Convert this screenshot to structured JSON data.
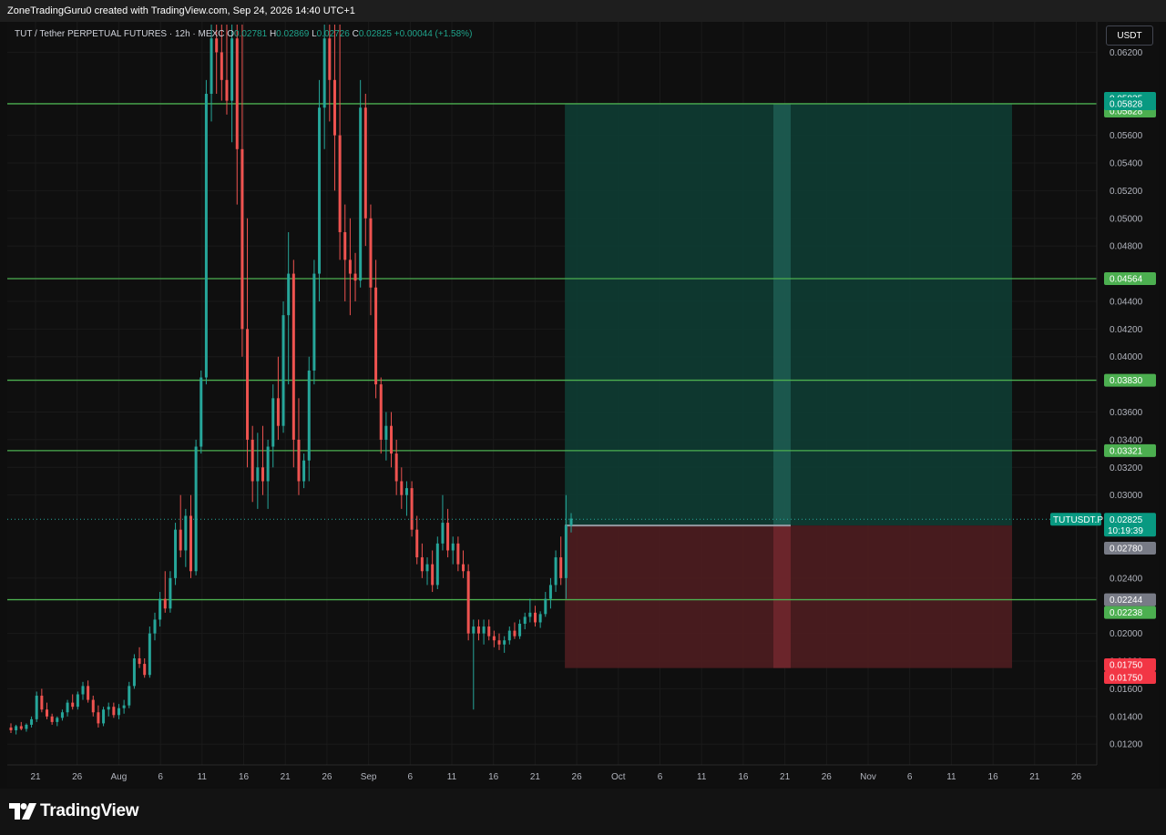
{
  "header": {
    "attribution": "ZoneTradingGuru0 created with TradingView.com, Sep 24, 2026 14:40 UTC+1"
  },
  "legend": {
    "symbol": "TUT / Tether PERPETUAL FUTURES · 12h · MEXC",
    "open_label": "O",
    "open": "0.02781",
    "high_label": "H",
    "high": "0.02869",
    "low_label": "L",
    "low": "0.02726",
    "close_label": "C",
    "close": "0.02825",
    "change": "+0.00044 (+1.58%)"
  },
  "currency_button": "USDT",
  "branding": {
    "logo_text": "TradingView"
  },
  "colors": {
    "up": "#26a69a",
    "down": "#ef5350",
    "level_line": "#4caf50",
    "target_zone": "#0f3a32",
    "stop_zone": "#4b1c20"
  },
  "chart_data": {
    "type": "candlestick",
    "symbol": "TUTUSDT.P",
    "timeframe": "12h",
    "y_axis": {
      "ticks": [
        "0.06200",
        "0.05600",
        "0.05400",
        "0.05200",
        "0.05000",
        "0.04800",
        "0.04400",
        "0.04200",
        "0.04000",
        "0.03600",
        "0.03400",
        "0.03200",
        "0.03000",
        "0.02400",
        "0.02000",
        "0.01800",
        "0.01600",
        "0.01400",
        "0.01200"
      ],
      "ylim": [
        0.0105,
        0.0642
      ]
    },
    "x_axis": {
      "ticks": [
        "21",
        "26",
        "Aug",
        "6",
        "11",
        "16",
        "21",
        "26",
        "Sep",
        "6",
        "11",
        "16",
        "21",
        "26",
        "Oct",
        "6",
        "11",
        "16",
        "21",
        "26",
        "Nov",
        "6",
        "11",
        "16",
        "21",
        "26"
      ]
    },
    "levels": [
      {
        "price": 0.05828,
        "label": "0.05828"
      },
      {
        "price": 0.04564,
        "label": "0.04564"
      },
      {
        "price": 0.0383,
        "label": "0.03830"
      },
      {
        "price": 0.03321,
        "label": "0.03321"
      },
      {
        "price": 0.02244,
        "label": "0.02244"
      }
    ],
    "position": {
      "type": "long",
      "entry": 0.0278,
      "target": 0.05828,
      "stop": 0.0175,
      "start_tick": "26",
      "end_after_tick": "16"
    },
    "price_labels": [
      {
        "text": "0.05835",
        "price": 0.05835,
        "kind": "up"
      },
      {
        "text": "0.05828",
        "price": 0.05828,
        "kind": "level"
      },
      {
        "text": "0.05828",
        "price": 0.05828,
        "kind": "up"
      },
      {
        "text": "0.04564",
        "price": 0.04564,
        "kind": "level"
      },
      {
        "text": "0.03830",
        "price": 0.0383,
        "kind": "level"
      },
      {
        "text": "0.03321",
        "price": 0.03321,
        "kind": "level"
      },
      {
        "text": "0.02780",
        "price": 0.0278,
        "kind": "gray"
      },
      {
        "text": "0.02244",
        "price": 0.02244,
        "kind": "gray"
      },
      {
        "text": "0.02238",
        "price": 0.02238,
        "kind": "level"
      },
      {
        "text": "0.01750",
        "price": 0.0175,
        "kind": "down"
      },
      {
        "text": "0.01750",
        "price": 0.0175,
        "kind": "down"
      }
    ],
    "last_price": {
      "symbol": "TUTUSDT.P",
      "value": "0.02825",
      "countdown": "10:19:39",
      "price": 0.02825
    },
    "ohlc": [
      [
        0.0132,
        0.0135,
        0.0128,
        0.013
      ],
      [
        0.013,
        0.0134,
        0.0127,
        0.0133
      ],
      [
        0.0133,
        0.0136,
        0.013,
        0.0131
      ],
      [
        0.0131,
        0.0135,
        0.0129,
        0.0134
      ],
      [
        0.0134,
        0.014,
        0.0132,
        0.0138
      ],
      [
        0.0138,
        0.0158,
        0.0136,
        0.0155
      ],
      [
        0.0155,
        0.016,
        0.0143,
        0.0145
      ],
      [
        0.0145,
        0.015,
        0.0138,
        0.014
      ],
      [
        0.014,
        0.0142,
        0.0134,
        0.0136
      ],
      [
        0.0136,
        0.014,
        0.0133,
        0.0139
      ],
      [
        0.0139,
        0.0145,
        0.0137,
        0.0143
      ],
      [
        0.0143,
        0.0152,
        0.014,
        0.015
      ],
      [
        0.015,
        0.0156,
        0.0145,
        0.0147
      ],
      [
        0.0147,
        0.0158,
        0.0145,
        0.0156
      ],
      [
        0.0156,
        0.0165,
        0.0152,
        0.0162
      ],
      [
        0.0162,
        0.0166,
        0.015,
        0.0152
      ],
      [
        0.0152,
        0.0155,
        0.014,
        0.0143
      ],
      [
        0.0143,
        0.0148,
        0.0132,
        0.0135
      ],
      [
        0.0135,
        0.0147,
        0.0133,
        0.0145
      ],
      [
        0.0145,
        0.015,
        0.014,
        0.0147
      ],
      [
        0.0147,
        0.015,
        0.0139,
        0.0141
      ],
      [
        0.0141,
        0.0149,
        0.0138,
        0.0146
      ],
      [
        0.0146,
        0.0152,
        0.0142,
        0.0148
      ],
      [
        0.0148,
        0.0165,
        0.0146,
        0.0162
      ],
      [
        0.0162,
        0.0185,
        0.016,
        0.0182
      ],
      [
        0.0182,
        0.019,
        0.0175,
        0.0178
      ],
      [
        0.0178,
        0.0182,
        0.0168,
        0.017
      ],
      [
        0.017,
        0.0205,
        0.0168,
        0.02
      ],
      [
        0.02,
        0.0215,
        0.0195,
        0.021
      ],
      [
        0.021,
        0.023,
        0.0205,
        0.0225
      ],
      [
        0.0225,
        0.0245,
        0.0215,
        0.0218
      ],
      [
        0.0218,
        0.0245,
        0.0215,
        0.024
      ],
      [
        0.024,
        0.028,
        0.0235,
        0.0275
      ],
      [
        0.0275,
        0.03,
        0.0255,
        0.026
      ],
      [
        0.026,
        0.029,
        0.0248,
        0.0285
      ],
      [
        0.0285,
        0.03,
        0.024,
        0.0245
      ],
      [
        0.0245,
        0.034,
        0.0242,
        0.0335
      ],
      [
        0.0335,
        0.039,
        0.033,
        0.0385
      ],
      [
        0.0385,
        0.06,
        0.038,
        0.059
      ],
      [
        0.059,
        0.064,
        0.057,
        0.063
      ],
      [
        0.063,
        0.064,
        0.059,
        0.062
      ],
      [
        0.062,
        0.064,
        0.0585,
        0.06
      ],
      [
        0.06,
        0.064,
        0.0575,
        0.0585
      ],
      [
        0.0585,
        0.064,
        0.0555,
        0.063
      ],
      [
        0.063,
        0.064,
        0.051,
        0.055
      ],
      [
        0.055,
        0.064,
        0.04,
        0.042
      ],
      [
        0.042,
        0.05,
        0.032,
        0.034
      ],
      [
        0.034,
        0.035,
        0.0295,
        0.031
      ],
      [
        0.031,
        0.0345,
        0.029,
        0.032
      ],
      [
        0.032,
        0.035,
        0.03,
        0.031
      ],
      [
        0.031,
        0.034,
        0.029,
        0.0335
      ],
      [
        0.0335,
        0.038,
        0.032,
        0.037
      ],
      [
        0.037,
        0.04,
        0.034,
        0.035
      ],
      [
        0.035,
        0.044,
        0.0345,
        0.043
      ],
      [
        0.043,
        0.049,
        0.038,
        0.046
      ],
      [
        0.046,
        0.047,
        0.032,
        0.034
      ],
      [
        0.034,
        0.037,
        0.03,
        0.031
      ],
      [
        0.031,
        0.033,
        0.0305,
        0.0325
      ],
      [
        0.0325,
        0.04,
        0.031,
        0.039
      ],
      [
        0.039,
        0.047,
        0.038,
        0.046
      ],
      [
        0.046,
        0.06,
        0.044,
        0.058
      ],
      [
        0.058,
        0.064,
        0.055,
        0.063
      ],
      [
        0.063,
        0.064,
        0.057,
        0.06
      ],
      [
        0.06,
        0.064,
        0.052,
        0.056
      ],
      [
        0.056,
        0.064,
        0.047,
        0.049
      ],
      [
        0.049,
        0.051,
        0.044,
        0.047
      ],
      [
        0.047,
        0.05,
        0.043,
        0.046
      ],
      [
        0.046,
        0.0475,
        0.044,
        0.0455
      ],
      [
        0.0455,
        0.06,
        0.045,
        0.058
      ],
      [
        0.058,
        0.059,
        0.048,
        0.05
      ],
      [
        0.05,
        0.051,
        0.043,
        0.045
      ],
      [
        0.045,
        0.047,
        0.037,
        0.038
      ],
      [
        0.038,
        0.0385,
        0.033,
        0.034
      ],
      [
        0.034,
        0.036,
        0.0325,
        0.035
      ],
      [
        0.035,
        0.036,
        0.032,
        0.033
      ],
      [
        0.033,
        0.034,
        0.03,
        0.031
      ],
      [
        0.031,
        0.032,
        0.029,
        0.03
      ],
      [
        0.03,
        0.031,
        0.0285,
        0.0305
      ],
      [
        0.0305,
        0.031,
        0.027,
        0.0275
      ],
      [
        0.0275,
        0.0285,
        0.025,
        0.0255
      ],
      [
        0.0255,
        0.0265,
        0.024,
        0.0245
      ],
      [
        0.0245,
        0.0255,
        0.0235,
        0.025
      ],
      [
        0.025,
        0.026,
        0.023,
        0.0235
      ],
      [
        0.0235,
        0.027,
        0.0232,
        0.0265
      ],
      [
        0.0265,
        0.03,
        0.026,
        0.028
      ],
      [
        0.028,
        0.029,
        0.0255,
        0.026
      ],
      [
        0.026,
        0.027,
        0.025,
        0.0265
      ],
      [
        0.0265,
        0.027,
        0.0245,
        0.025
      ],
      [
        0.025,
        0.026,
        0.024,
        0.0245
      ],
      [
        0.0245,
        0.025,
        0.0195,
        0.02
      ],
      [
        0.02,
        0.021,
        0.0145,
        0.0205
      ],
      [
        0.0205,
        0.021,
        0.0195,
        0.02
      ],
      [
        0.02,
        0.021,
        0.0192,
        0.0205
      ],
      [
        0.0205,
        0.021,
        0.0195,
        0.0198
      ],
      [
        0.0198,
        0.0202,
        0.019,
        0.0195
      ],
      [
        0.0195,
        0.02,
        0.0188,
        0.0192
      ],
      [
        0.0192,
        0.0198,
        0.0186,
        0.0195
      ],
      [
        0.0195,
        0.0205,
        0.0192,
        0.0202
      ],
      [
        0.0202,
        0.0208,
        0.0196,
        0.0198
      ],
      [
        0.0198,
        0.021,
        0.0196,
        0.0207
      ],
      [
        0.0207,
        0.0215,
        0.0203,
        0.0212
      ],
      [
        0.0212,
        0.0225,
        0.0208,
        0.0215
      ],
      [
        0.0215,
        0.022,
        0.0205,
        0.0208
      ],
      [
        0.0208,
        0.0216,
        0.0204,
        0.0214
      ],
      [
        0.0214,
        0.023,
        0.0212,
        0.0225
      ],
      [
        0.0225,
        0.024,
        0.0218,
        0.0235
      ],
      [
        0.0235,
        0.026,
        0.023,
        0.0255
      ],
      [
        0.0255,
        0.027,
        0.0235,
        0.024
      ],
      [
        0.024,
        0.03,
        0.0225,
        0.0278
      ],
      [
        0.0278,
        0.0287,
        0.0273,
        0.0283
      ]
    ]
  }
}
